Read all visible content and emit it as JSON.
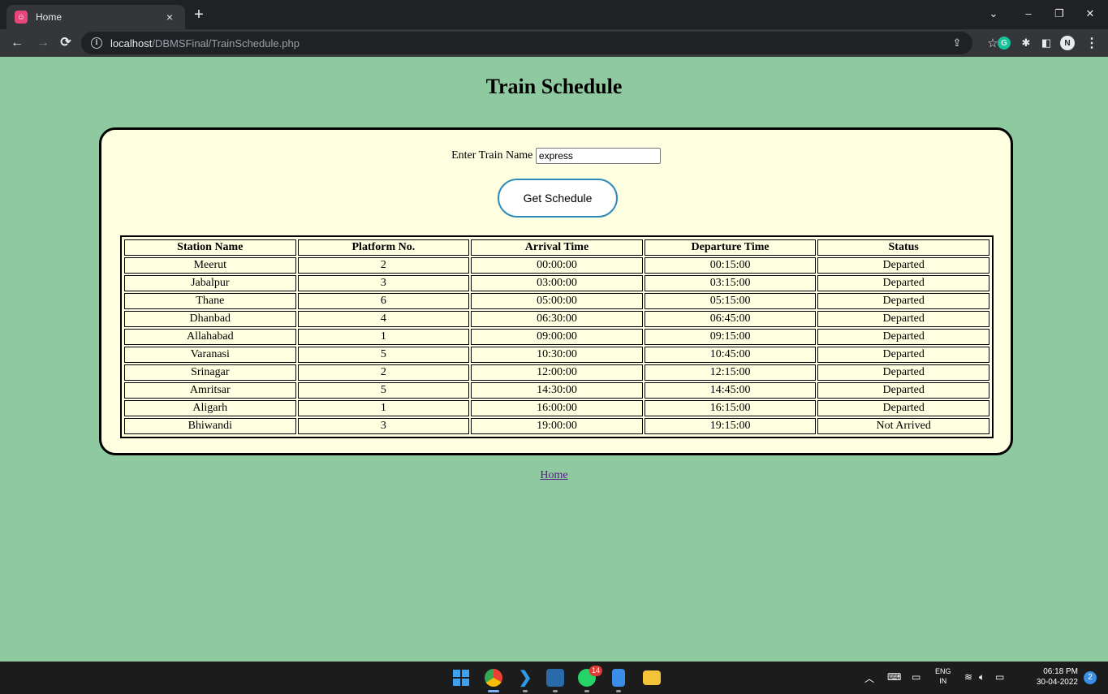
{
  "browser": {
    "tab_title": "Home",
    "tab_close": "×",
    "new_tab": "+",
    "url_host": "localhost",
    "url_path": "/DBMSFinal/TrainSchedule.php",
    "window_controls": {
      "tabsearch": "⌄",
      "minimize": "–",
      "restore": "❐",
      "close": "✕"
    }
  },
  "page": {
    "title": "Train Schedule",
    "form": {
      "label": "Enter Train Name",
      "train_name_value": "express",
      "submit_label": "Get Schedule"
    },
    "table": {
      "columns": [
        "Station Name",
        "Platform No.",
        "Arrival Time",
        "Departure Time",
        "Status"
      ],
      "rows": [
        [
          "Meerut",
          "2",
          "00:00:00",
          "00:15:00",
          "Departed"
        ],
        [
          "Jabalpur",
          "3",
          "03:00:00",
          "03:15:00",
          "Departed"
        ],
        [
          "Thane",
          "6",
          "05:00:00",
          "05:15:00",
          "Departed"
        ],
        [
          "Dhanbad",
          "4",
          "06:30:00",
          "06:45:00",
          "Departed"
        ],
        [
          "Allahabad",
          "1",
          "09:00:00",
          "09:15:00",
          "Departed"
        ],
        [
          "Varanasi",
          "5",
          "10:30:00",
          "10:45:00",
          "Departed"
        ],
        [
          "Srinagar",
          "2",
          "12:00:00",
          "12:15:00",
          "Departed"
        ],
        [
          "Amritsar",
          "5",
          "14:30:00",
          "14:45:00",
          "Departed"
        ],
        [
          "Aligarh",
          "1",
          "16:00:00",
          "16:15:00",
          "Departed"
        ],
        [
          "Bhiwandi",
          "3",
          "19:00:00",
          "19:15:00",
          "Not Arrived"
        ]
      ]
    },
    "home_link": "Home"
  },
  "taskbar": {
    "whatsapp_badge": "14",
    "lang_top": "ENG",
    "lang_bottom": "IN",
    "time": "06:18 PM",
    "date": "30-04-2022",
    "notification_count": "2"
  },
  "colors": {
    "page_bg": "#8fc99f",
    "panel_bg": "#fefee0",
    "button_border": "#2e8bb9",
    "link": "#551a8b"
  }
}
